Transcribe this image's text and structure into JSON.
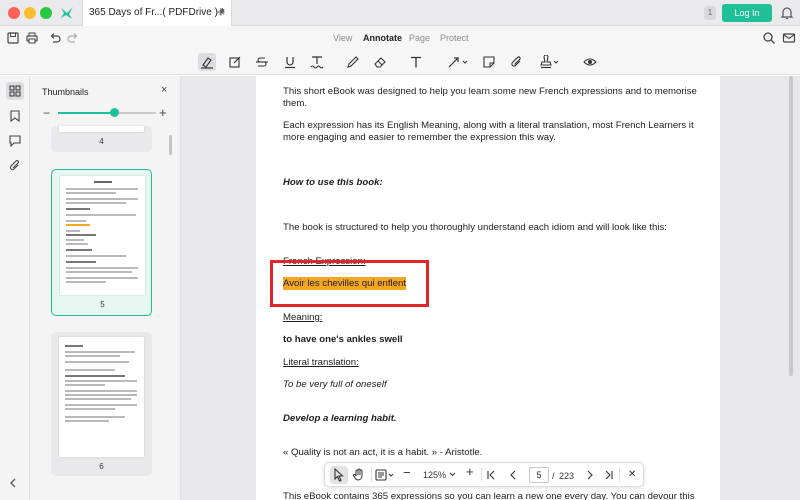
{
  "titlebar": {
    "tab_title": "365 Days of Fr...( PDFDrive ) *",
    "tab_close": "×",
    "new_tab": "+",
    "badge": "1",
    "login": "Log In"
  },
  "menu": {
    "tabs": [
      {
        "label": "View",
        "active": false
      },
      {
        "label": "Annotate",
        "active": true
      },
      {
        "label": "Page",
        "active": false
      },
      {
        "label": "Protect",
        "active": false
      }
    ]
  },
  "tools": [
    "highlight-icon",
    "sticky-note-icon",
    "strikethrough-icon",
    "underline-icon",
    "squiggly-icon",
    "pencil-icon",
    "eraser-icon",
    "text-icon",
    "arrow-icon",
    "note-icon",
    "attachment-icon",
    "stamp-icon",
    "eye-icon"
  ],
  "panel": {
    "title": "Thumbnails",
    "close": "×",
    "minus": "−",
    "plus": "+",
    "zoom_fraction": 0.58,
    "thumbnails": [
      {
        "label": "4"
      },
      {
        "label": "5"
      },
      {
        "label": "6"
      }
    ]
  },
  "document": {
    "p1": "This short eBook was designed to help you learn some new French expressions and to memorise them.",
    "p2": "Each expression has its English Meaning, along with a literal translation, most French Learners it more engaging and easier to remember the expression this way.",
    "h1": "How to use this book:",
    "p3": "The book is structured to help you thoroughly understand each idiom and will look like this:",
    "french_label": "French Expression:",
    "french_value": "Avoir les chevilles qui enflent",
    "meaning_label": "Meaning:",
    "meaning_value": "to have one's ankles swell",
    "literal_label": "Literal translation:",
    "literal_value": "To be very full of oneself",
    "h2": "Develop a learning habit.",
    "quote": "« Quality is not an act, it is a habit. » - Aristotle.",
    "p4": "This eBook contains 365 expressions so you can learn a new one every day. You can devour this"
  },
  "bottombar": {
    "zoom": "125%",
    "current_page": "5",
    "separator": "/",
    "total_pages": "223",
    "zoom_minus": "−",
    "zoom_plus": "+",
    "close": "✕"
  },
  "colors": {
    "accent": "#1fbf98",
    "highlight": "#f5a623",
    "annotation_box": "#e0262b"
  }
}
